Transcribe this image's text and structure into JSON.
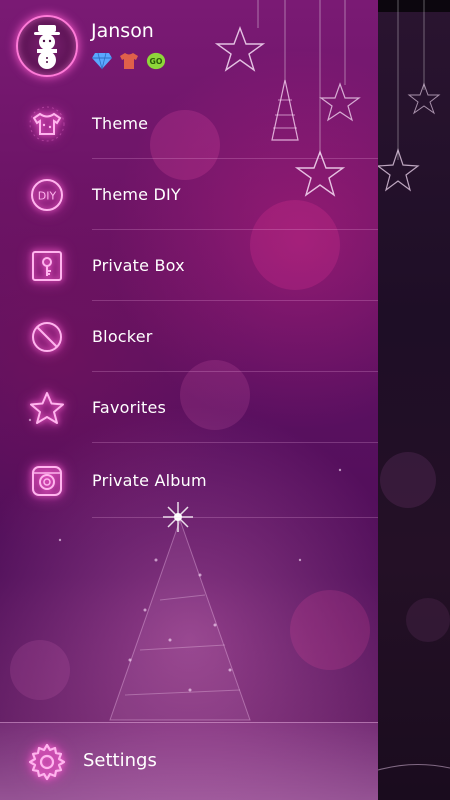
{
  "profile": {
    "name": "Janson",
    "avatar_icon": "snowman-icon",
    "badges": [
      {
        "icon": "diamond-icon",
        "color": "#5aa8ff"
      },
      {
        "icon": "tshirt-icon",
        "color": "#e0604a"
      },
      {
        "icon": "go-icon",
        "color": "#8ed63a",
        "text": "GO"
      }
    ]
  },
  "menu": {
    "items": [
      {
        "label": "Theme",
        "icon": "tshirt-icon"
      },
      {
        "label": "Theme DIY",
        "icon": "diy-icon",
        "icon_text": "DIY"
      },
      {
        "label": "Private Box",
        "icon": "lock-box-icon"
      },
      {
        "label": "Blocker",
        "icon": "block-icon"
      },
      {
        "label": "Favorites",
        "icon": "star-icon"
      },
      {
        "label": "Private Album",
        "icon": "camera-icon"
      }
    ]
  },
  "settings": {
    "label": "Settings",
    "icon": "gear-icon"
  },
  "colors": {
    "accent": "#ff6ad5",
    "text": "#ffffff",
    "background": "#5a1060"
  }
}
